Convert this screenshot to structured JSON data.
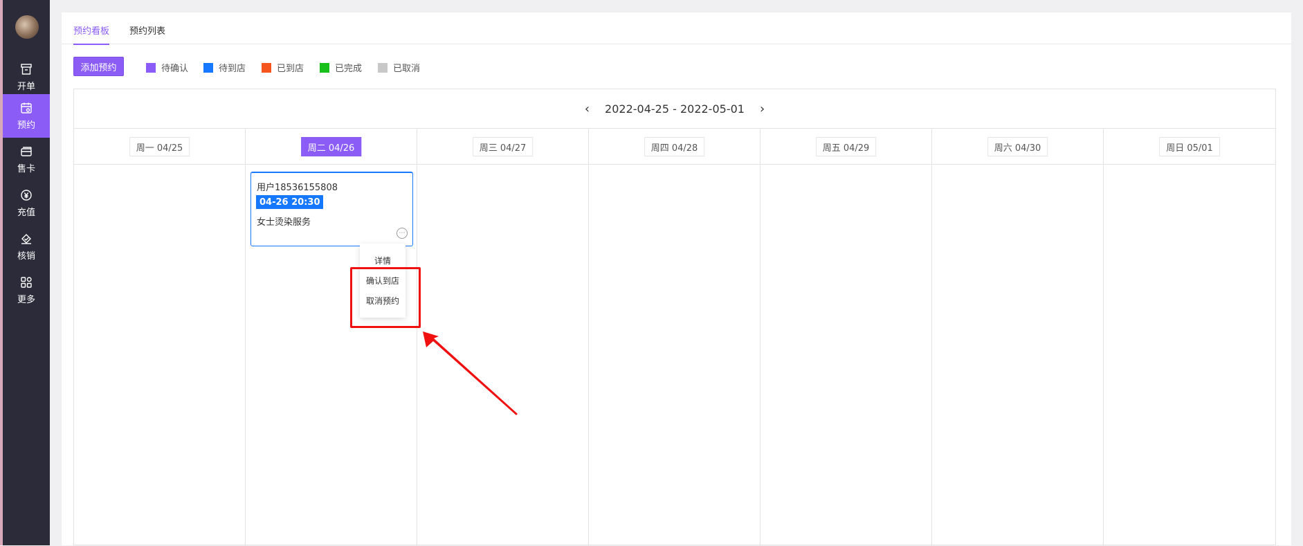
{
  "sidebar": {
    "items": [
      {
        "label": "开单",
        "icon": "order-icon"
      },
      {
        "label": "预约",
        "icon": "calendar-icon"
      },
      {
        "label": "售卡",
        "icon": "card-icon"
      },
      {
        "label": "充值",
        "icon": "yuan-icon"
      },
      {
        "label": "核销",
        "icon": "verify-icon"
      },
      {
        "label": "更多",
        "icon": "grid-icon"
      }
    ],
    "active": "预约"
  },
  "tabs": [
    {
      "label": "预约看板",
      "active": true
    },
    {
      "label": "预约列表",
      "active": false
    }
  ],
  "toolbar": {
    "add_label": "添加预约"
  },
  "legend": [
    {
      "label": "待确认",
      "color": "#8b5cf6"
    },
    {
      "label": "待到店",
      "color": "#1677ff"
    },
    {
      "label": "已到店",
      "color": "#f5541c"
    },
    {
      "label": "已完成",
      "color": "#19c01a"
    },
    {
      "label": "已取消",
      "color": "#c8c8c8"
    }
  ],
  "calendar": {
    "range": "2022-04-25 - 2022-05-01",
    "prev_icon": "chevron-left-icon",
    "next_icon": "chevron-right-icon",
    "days": [
      {
        "label": "周一 04/25",
        "active": false
      },
      {
        "label": "周二 04/26",
        "active": true
      },
      {
        "label": "周三 04/27",
        "active": false
      },
      {
        "label": "周四 04/28",
        "active": false
      },
      {
        "label": "周五 04/29",
        "active": false
      },
      {
        "label": "周六 04/30",
        "active": false
      },
      {
        "label": "周日 05/01",
        "active": false
      }
    ]
  },
  "appointment": {
    "user": "用户18536155808",
    "time": "04-26 20:30",
    "service": "女士烫染服务",
    "more_icon": "ellipsis-icon"
  },
  "dropdown": {
    "items": [
      "详情",
      "确认到店",
      "取消预约"
    ]
  },
  "colors": {
    "accent": "#8b5cf6",
    "sidebar_bg": "#2b2b3a",
    "blue": "#1677ff",
    "annotation_red": "#f01010"
  }
}
